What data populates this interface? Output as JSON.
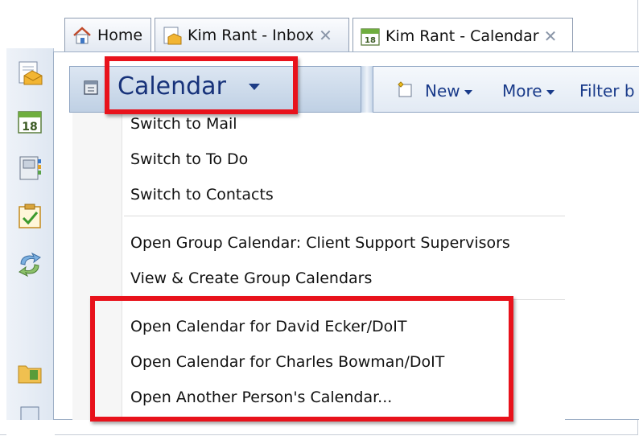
{
  "tabs": [
    {
      "label": "Home",
      "icon": "home-icon",
      "closable": false
    },
    {
      "label": "Kim Rant - Inbox",
      "icon": "inbox-icon",
      "closable": true
    },
    {
      "label": "Kim Rant - Calendar",
      "icon": "calendar-icon",
      "closable": true,
      "active": true
    }
  ],
  "tab_close_glyph": "✕",
  "sidebar_icons": [
    "mail-icon",
    "calendar-18-icon",
    "contacts-icon",
    "tasks-icon",
    "sync-icon",
    "folder-icon"
  ],
  "calendar_icon_text": "18",
  "header": {
    "title": "Calendar",
    "toolbar": {
      "new_label": "New",
      "more_label": "More",
      "filter_label": "Filter b"
    }
  },
  "menu": {
    "group1": [
      "Switch to Mail",
      "Switch to To Do",
      "Switch to Contacts"
    ],
    "group2": [
      "Open Group Calendar: Client Support Supervisors",
      "View & Create Group Calendars"
    ],
    "group3": [
      "Open Calendar for David Ecker/DoIT",
      "Open Calendar for Charles Bowman/DoIT",
      "Open Another Person's Calendar..."
    ]
  },
  "colors": {
    "highlight": "#e8121b",
    "title": "#17327a",
    "toolbar_text": "#1a3b8a"
  }
}
